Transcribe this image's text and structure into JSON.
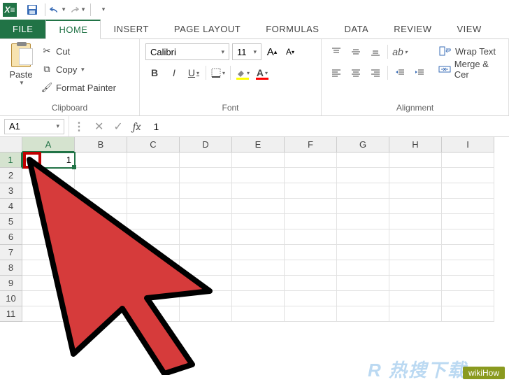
{
  "qat": {
    "save": "save",
    "undo": "undo",
    "redo": "redo"
  },
  "tabs": {
    "file": "FILE",
    "home": "HOME",
    "insert": "INSERT",
    "page_layout": "PAGE LAYOUT",
    "formulas": "FORMULAS",
    "data": "DATA",
    "review": "REVIEW",
    "view": "VIEW"
  },
  "ribbon": {
    "clipboard": {
      "label": "Clipboard",
      "paste": "Paste",
      "cut": "Cut",
      "copy": "Copy",
      "format_painter": "Format Painter"
    },
    "font": {
      "label": "Font",
      "name": "Calibri",
      "size": "11"
    },
    "alignment": {
      "label": "Alignment",
      "wrap_text": "Wrap Text",
      "merge_center": "Merge & Cer"
    }
  },
  "formula_bar": {
    "name_box": "A1",
    "fx": "fx",
    "value": "1"
  },
  "grid": {
    "columns": [
      "A",
      "B",
      "C",
      "D",
      "E",
      "F",
      "G",
      "H",
      "I"
    ],
    "rows": [
      "1",
      "2",
      "3",
      "4",
      "5",
      "6",
      "7",
      "8",
      "9",
      "10",
      "11"
    ],
    "active_cell_value": "1"
  },
  "watermark": {
    "text": "wikiHow",
    "cn": "R 热搜下载"
  }
}
